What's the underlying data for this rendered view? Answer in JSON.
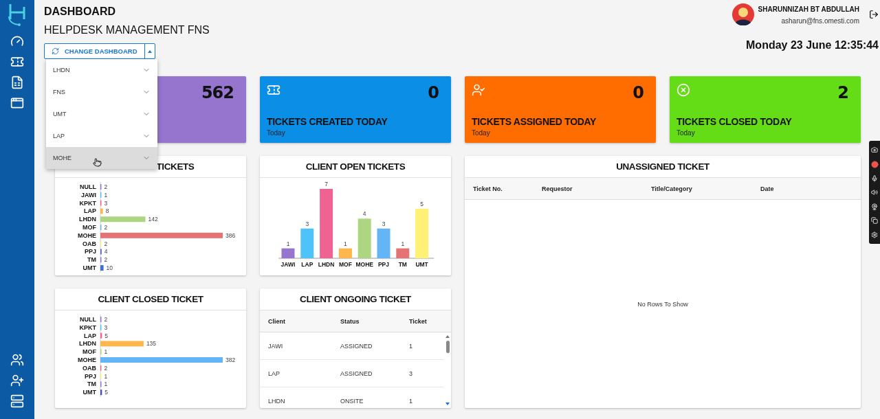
{
  "header": {
    "title": "DASHBOARD",
    "subtitle": "HELPDESK MANAGEMENT FNS"
  },
  "user": {
    "name": "SHARUNNIZAH BT ABDULLAH",
    "email": "asharun@fns.omesti.com"
  },
  "datetime": "Monday 23 June 12:35:44",
  "change_dashboard": {
    "label": "CHANGE DASHBOARD",
    "expanded": true,
    "items": [
      {
        "label": "LHDN",
        "selected": false
      },
      {
        "label": "FNS",
        "selected": false
      },
      {
        "label": "UMT",
        "selected": false
      },
      {
        "label": "LAP",
        "selected": false
      },
      {
        "label": "MOHE",
        "selected": true
      }
    ]
  },
  "stat_cards": [
    {
      "kind": "total",
      "value": "562",
      "color": "#9575cd"
    },
    {
      "kind": "created",
      "value": "0",
      "title": "TICKETS CREATED TODAY",
      "subtitle": "Today",
      "color": "#0a8ee6"
    },
    {
      "kind": "assigned",
      "value": "0",
      "title": "TICKETS ASSIGNED TODAY",
      "subtitle": "Today",
      "color": "#ff6d00"
    },
    {
      "kind": "closed",
      "value": "2",
      "title": "TICKETS CLOSED TODAY",
      "subtitle": "Today",
      "color": "#64dd17"
    }
  ],
  "client_total_tickets": {
    "title": "TICKETS",
    "bars": [
      {
        "color": "#9575cd"
      },
      {
        "color": "#4fc3f7"
      },
      {
        "color": "#f06292"
      },
      {
        "color": "#ffb74d"
      },
      {
        "color": "#aed581"
      },
      {
        "color": "#64b5f6"
      },
      {
        "color": "#e57373"
      },
      {
        "color": "#fff176"
      },
      {
        "color": "#5c6bc0"
      },
      {
        "color": "#9575cd"
      },
      {
        "color": "#3f6fd1"
      }
    ],
    "chart_data": {
      "type": "bar",
      "orientation": "horizontal",
      "categories": [
        "NULL",
        "JAWI",
        "KPKT",
        "LAP",
        "LHDN",
        "MOF",
        "MOHE",
        "OAB",
        "PPJ",
        "TM",
        "UMT"
      ],
      "values": [
        2,
        1,
        3,
        8,
        142,
        2,
        386,
        2,
        4,
        2,
        10
      ],
      "data_labels": true
    }
  },
  "client_open_tickets": {
    "title": "CLIENT OPEN TICKETS",
    "bars": [
      {
        "color": "#9575cd"
      },
      {
        "color": "#4fc3f7"
      },
      {
        "color": "#f06292"
      },
      {
        "color": "#ffb74d"
      },
      {
        "color": "#aed581"
      },
      {
        "color": "#64b5f6"
      },
      {
        "color": "#e57373"
      },
      {
        "color": "#fff176"
      }
    ],
    "chart_data": {
      "type": "bar",
      "orientation": "vertical",
      "categories": [
        "JAWI",
        "LAP",
        "LHDN",
        "MOF",
        "MOHE",
        "PPJ",
        "TM",
        "UMT"
      ],
      "values": [
        1,
        3,
        7,
        1,
        4,
        3,
        1,
        5
      ],
      "data_labels": true
    }
  },
  "unassigned_ticket": {
    "title": "UNASSIGNED TICKET",
    "columns": [
      "Ticket No.",
      "Requestor",
      "Title/Category",
      "Date"
    ],
    "empty_message": "No Rows To Show"
  },
  "client_closed_ticket": {
    "title": "CLIENT CLOSED TICKET",
    "bars": [
      {
        "color": "#9575cd"
      },
      {
        "color": "#4fc3f7"
      },
      {
        "color": "#f06292"
      },
      {
        "color": "#ffb74d"
      },
      {
        "color": "#aed581"
      },
      {
        "color": "#64b5f6"
      },
      {
        "color": "#e57373"
      },
      {
        "color": "#fff176"
      },
      {
        "color": "#9575cd"
      },
      {
        "color": "#3f51b5"
      }
    ],
    "chart_data": {
      "type": "bar",
      "orientation": "horizontal",
      "categories": [
        "NULL",
        "KPKT",
        "LAP",
        "LHDN",
        "MOF",
        "MOHE",
        "OAB",
        "PPJ",
        "TM",
        "UMT"
      ],
      "values": [
        2,
        3,
        5,
        135,
        1,
        382,
        2,
        1,
        1,
        5
      ],
      "data_labels": true
    }
  },
  "client_ongoing_ticket": {
    "title": "CLIENT ONGOING TICKET",
    "columns": [
      "Client",
      "Status",
      "Ticket"
    ],
    "rows": [
      [
        "JAWI",
        "ASSIGNED",
        "1"
      ],
      [
        "LAP",
        "ASSIGNED",
        "3"
      ],
      [
        "LHDN",
        "ONSITE",
        "1"
      ]
    ]
  }
}
